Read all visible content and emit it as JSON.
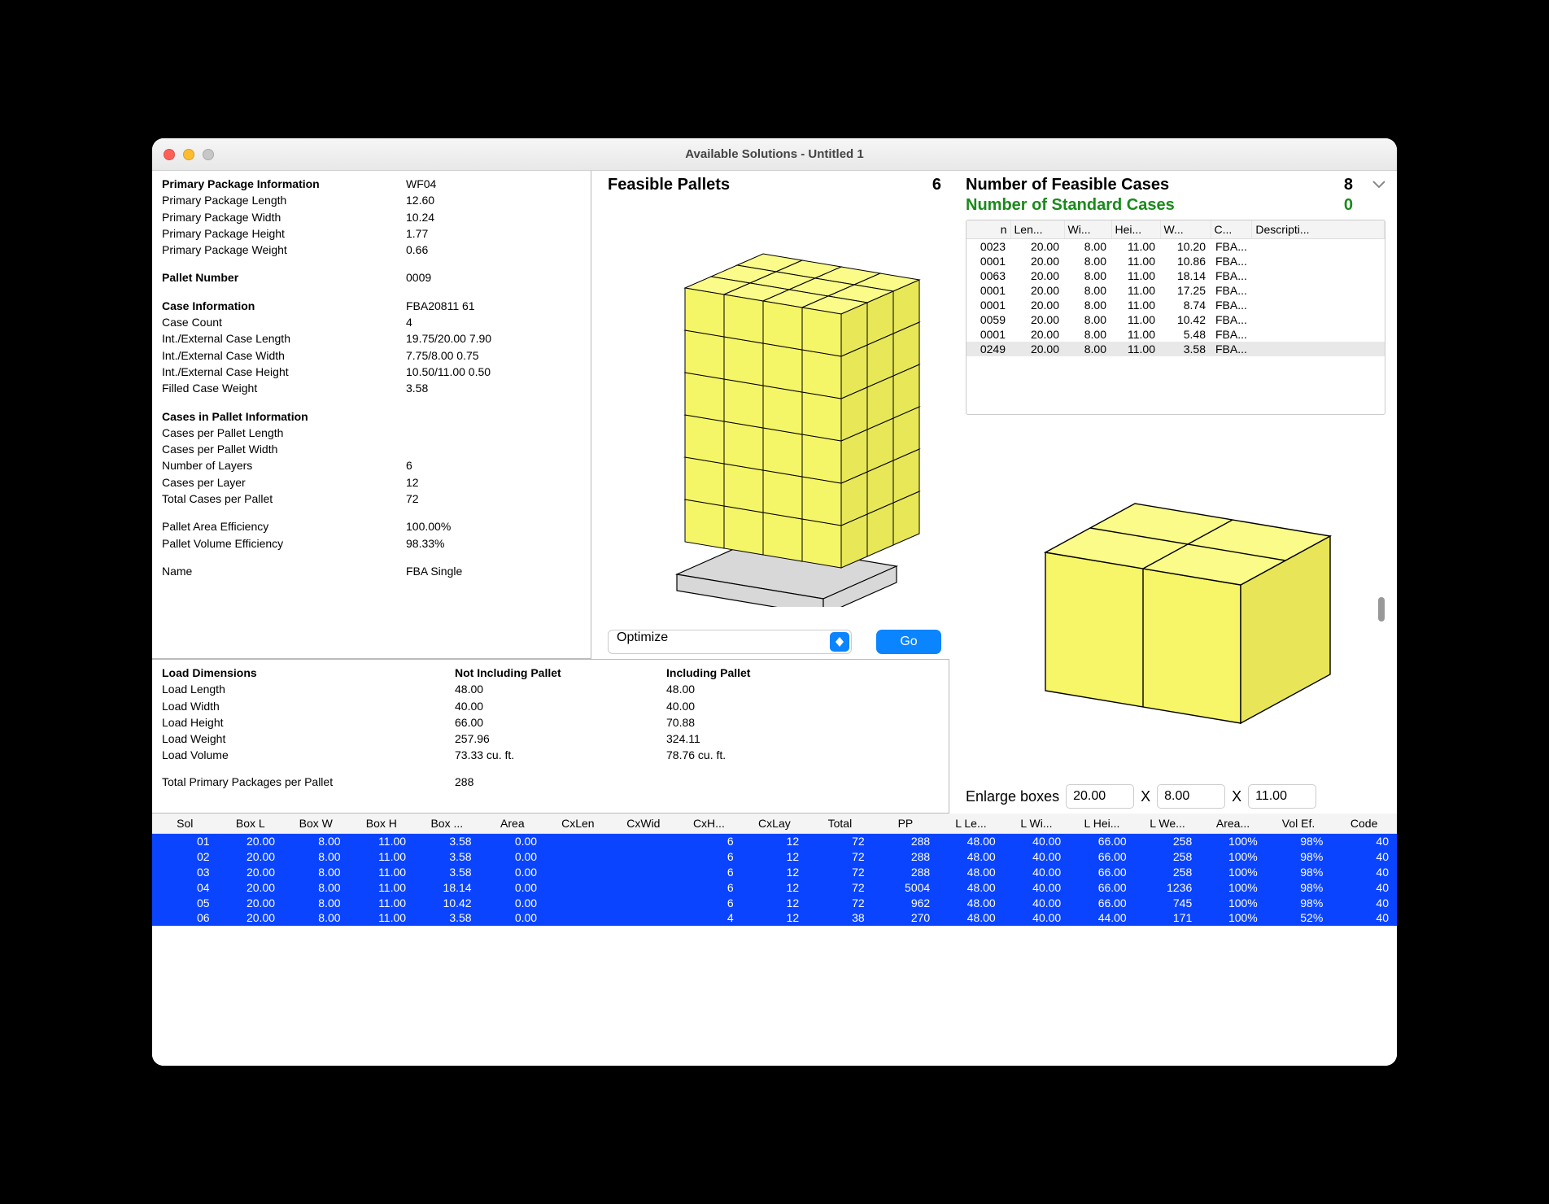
{
  "window": {
    "title": "Available Solutions - Untitled 1"
  },
  "info": {
    "primary_header": "Primary Package Information",
    "primary_value": "WF04",
    "pp_length_l": "Primary Package Length",
    "pp_length_v": "12.60",
    "pp_width_l": "Primary Package Width",
    "pp_width_v": "10.24",
    "pp_height_l": "Primary Package Height",
    "pp_height_v": "1.77",
    "pp_weight_l": "Primary Package Weight",
    "pp_weight_v": "0.66",
    "pallet_num_l": "Pallet Number",
    "pallet_num_v": "0009",
    "case_header": "Case Information",
    "case_header_v": "FBA20811 61",
    "case_count_l": "Case Count",
    "case_count_v": "4",
    "case_len_l": "Int./External Case Length",
    "case_len_v": "19.75/20.00   7.90",
    "case_wid_l": "Int./External Case Width",
    "case_wid_v": "7.75/8.00   0.75",
    "case_hei_l": "Int./External Case Height",
    "case_hei_v": "10.50/11.00   0.50",
    "case_wt_l": "Filled Case Weight",
    "case_wt_v": "3.58",
    "cip_header": "Cases in Pallet Information",
    "cpl_l": "Cases per Pallet Length",
    "cpl_v": "",
    "cpw_l": "Cases per Pallet Width",
    "cpw_v": "",
    "layers_l": "Number of Layers",
    "layers_v": "6",
    "cplay_l": "Cases per Layer",
    "cplay_v": "12",
    "total_l": "Total Cases per Pallet",
    "total_v": "72",
    "area_eff_l": "Pallet Area Efficiency",
    "area_eff_v": "100.00%",
    "vol_eff_l": "Pallet Volume Efficiency",
    "vol_eff_v": "98.33%",
    "name_l": "Name",
    "name_v": "FBA Single"
  },
  "pallet": {
    "header": "Feasible Pallets",
    "count": "6",
    "select_value": "Optimize",
    "go_label": "Go"
  },
  "cases": {
    "header": "Number of Feasible Cases",
    "count": "8",
    "std_header": "Number of Standard Cases",
    "std_count": "0",
    "cols": {
      "n": "n",
      "len": "Len...",
      "wi": "Wi...",
      "hei": "Hei...",
      "w": "W...",
      "c": "C...",
      "desc": "Descripti..."
    },
    "rows": [
      {
        "n": "0023",
        "len": "20.00",
        "wi": "8.00",
        "hei": "11.00",
        "w": "10.20",
        "c": "FBA..."
      },
      {
        "n": "0001",
        "len": "20.00",
        "wi": "8.00",
        "hei": "11.00",
        "w": "10.86",
        "c": "FBA..."
      },
      {
        "n": "0063",
        "len": "20.00",
        "wi": "8.00",
        "hei": "11.00",
        "w": "18.14",
        "c": "FBA..."
      },
      {
        "n": "0001",
        "len": "20.00",
        "wi": "8.00",
        "hei": "11.00",
        "w": "17.25",
        "c": "FBA..."
      },
      {
        "n": "0001",
        "len": "20.00",
        "wi": "8.00",
        "hei": "11.00",
        "w": "8.74",
        "c": "FBA..."
      },
      {
        "n": "0059",
        "len": "20.00",
        "wi": "8.00",
        "hei": "11.00",
        "w": "10.42",
        "c": "FBA..."
      },
      {
        "n": "0001",
        "len": "20.00",
        "wi": "8.00",
        "hei": "11.00",
        "w": "5.48",
        "c": "FBA..."
      },
      {
        "n": "0249",
        "len": "20.00",
        "wi": "8.00",
        "hei": "11.00",
        "w": "3.58",
        "c": "FBA...",
        "sel": true
      }
    ],
    "enlarge_label": "Enlarge boxes",
    "enlarge_x": "20.00",
    "enlarge_y": "8.00",
    "enlarge_z": "11.00",
    "x_sym": "X"
  },
  "load": {
    "dim_l": "Load Dimensions",
    "not_inc": "Not Including Pallet",
    "inc": "Including Pallet",
    "len_l": "Load Length",
    "len_a": "48.00",
    "len_b": "48.00",
    "wid_l": "Load Width",
    "wid_a": "40.00",
    "wid_b": "40.00",
    "hei_l": "Load Height",
    "hei_a": "66.00",
    "hei_b": "70.88",
    "wt_l": "Load Weight",
    "wt_a": "257.96",
    "wt_b": "324.11",
    "vol_l": "Load Volume",
    "vol_a": "73.33 cu. ft.",
    "vol_b": "78.76 cu. ft.",
    "tpp_l": "Total Primary Packages per Pallet",
    "tpp_v": "288"
  },
  "solutions": {
    "cols": [
      "Sol",
      "Box L",
      "Box W",
      "Box H",
      "Box ...",
      "Area",
      "CxLen",
      "CxWid",
      "CxH...",
      "CxLay",
      "Total",
      "PP",
      "L Le...",
      "L Wi...",
      "L Hei...",
      "L We...",
      "Area...",
      "Vol Ef.",
      "Code"
    ],
    "rows": [
      [
        "01",
        "20.00",
        "8.00",
        "11.00",
        "3.58",
        "0.00",
        "",
        "",
        "6",
        "12",
        "72",
        "288",
        "48.00",
        "40.00",
        "66.00",
        "258",
        "100%",
        "98%",
        "40"
      ],
      [
        "02",
        "20.00",
        "8.00",
        "11.00",
        "3.58",
        "0.00",
        "",
        "",
        "6",
        "12",
        "72",
        "288",
        "48.00",
        "40.00",
        "66.00",
        "258",
        "100%",
        "98%",
        "40"
      ],
      [
        "03",
        "20.00",
        "8.00",
        "11.00",
        "3.58",
        "0.00",
        "",
        "",
        "6",
        "12",
        "72",
        "288",
        "48.00",
        "40.00",
        "66.00",
        "258",
        "100%",
        "98%",
        "40"
      ],
      [
        "04",
        "20.00",
        "8.00",
        "11.00",
        "18.14",
        "0.00",
        "",
        "",
        "6",
        "12",
        "72",
        "5004",
        "48.00",
        "40.00",
        "66.00",
        "1236",
        "100%",
        "98%",
        "40"
      ],
      [
        "05",
        "20.00",
        "8.00",
        "11.00",
        "10.42",
        "0.00",
        "",
        "",
        "6",
        "12",
        "72",
        "962",
        "48.00",
        "40.00",
        "66.00",
        "745",
        "100%",
        "98%",
        "40"
      ],
      [
        "06",
        "20.00",
        "8.00",
        "11.00",
        "3.58",
        "0.00",
        "",
        "",
        "4",
        "12",
        "38",
        "270",
        "48.00",
        "40.00",
        "44.00",
        "171",
        "100%",
        "52%",
        "40"
      ]
    ]
  }
}
